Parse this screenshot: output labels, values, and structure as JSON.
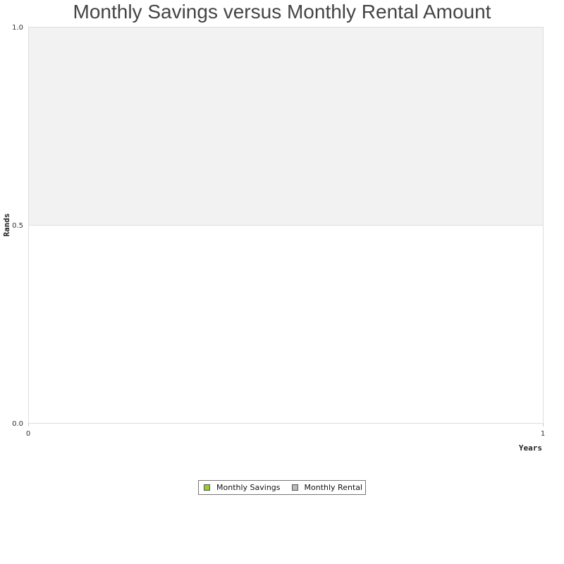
{
  "chart_data": {
    "type": "line",
    "title": "Monthly Savings versus Monthly Rental Amount",
    "xlabel": "Years",
    "ylabel": "Rands",
    "xlim": [
      0,
      1
    ],
    "ylim": [
      0.0,
      1.0
    ],
    "x_ticks": [
      "0",
      "1"
    ],
    "y_ticks": [
      "0.0",
      "0.5",
      "1.0"
    ],
    "y_tick_values": [
      0.0,
      0.5,
      1.0
    ],
    "x_tick_values": [
      0,
      1
    ],
    "grid": true,
    "legend_position": "bottom-center",
    "series": [
      {
        "name": "Monthly Savings",
        "color": "#99cc33",
        "values": []
      },
      {
        "name": "Monthly Rental",
        "color": "#bbbbbb",
        "values": []
      }
    ],
    "plot_bands": [
      {
        "from": 0.5,
        "to": 1.0,
        "color": "#f2f2f2"
      }
    ]
  }
}
